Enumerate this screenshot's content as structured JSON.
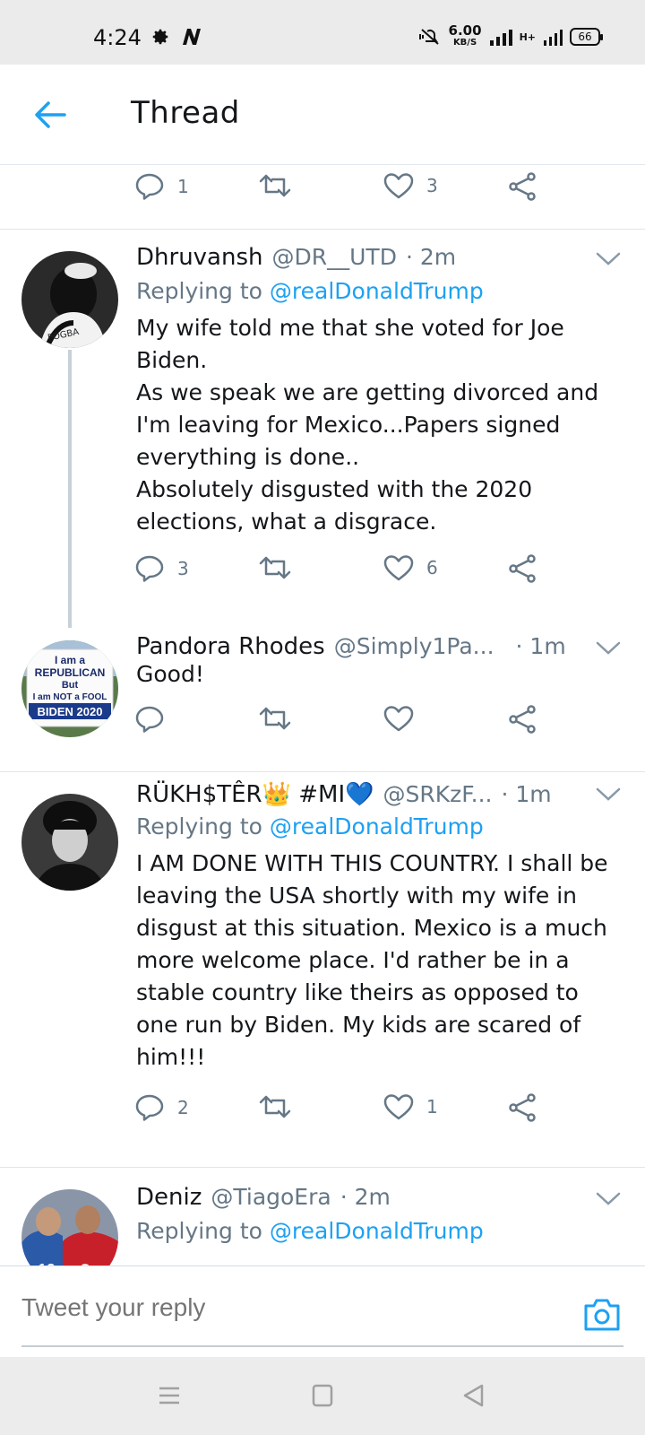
{
  "status_bar": {
    "time": "4:24",
    "speed_value": "6.00",
    "speed_unit": "KB/S",
    "network": "H+",
    "battery": "66"
  },
  "header": {
    "title": "Thread"
  },
  "prev_tweet_actions": {
    "replies": "1",
    "retweets": "",
    "likes": "3"
  },
  "tweets": [
    {
      "name": "Dhruvansh",
      "handle": "@DR__UTD",
      "time": "· 2m",
      "replying_prefix": "Replying to",
      "replying_to": "@realDonaldTrump",
      "text": "My wife told me that she voted for Joe Biden.\nAs we speak we are getting divorced and I'm leaving for Mexico...Papers signed everything is done..\nAbsolutely disgusted with the 2020 elections, what a disgrace.",
      "replies": "3",
      "retweets": "",
      "likes": "6"
    },
    {
      "name": "Pandora Rhodes",
      "handle": "@Simply1Pa...",
      "time": "· 1m",
      "text": "Good!",
      "replies": "",
      "retweets": "",
      "likes": "",
      "avatar_text": [
        "I am a",
        "REPUBLICAN",
        "But",
        "I am NOT a FOOL",
        "BIDEN 2020"
      ]
    },
    {
      "name": "RÜKH$TÊR👑 #MI💙",
      "handle": "@SRKzF...",
      "time": "· 1m",
      "replying_prefix": "Replying to",
      "replying_to": "@realDonaldTrump",
      "text": "I AM DONE WITH THIS COUNTRY.  I shall be leaving the USA shortly with my wife in disgust at this situation. Mexico is a much more welcome place. I'd rather be in a stable country like theirs as opposed to one run by Biden. My kids are scared of him!!!",
      "replies": "2",
      "retweets": "",
      "likes": "1"
    },
    {
      "name": "Deniz",
      "handle": "@TiagoEra",
      "time": "· 2m",
      "replying_prefix": "Replying to",
      "replying_to": "@realDonaldTrump"
    }
  ],
  "reply_bar": {
    "placeholder": "Tweet your reply"
  },
  "colors": {
    "accent": "#1da1f2",
    "muted": "#657786",
    "divider": "#dfe5ea"
  }
}
